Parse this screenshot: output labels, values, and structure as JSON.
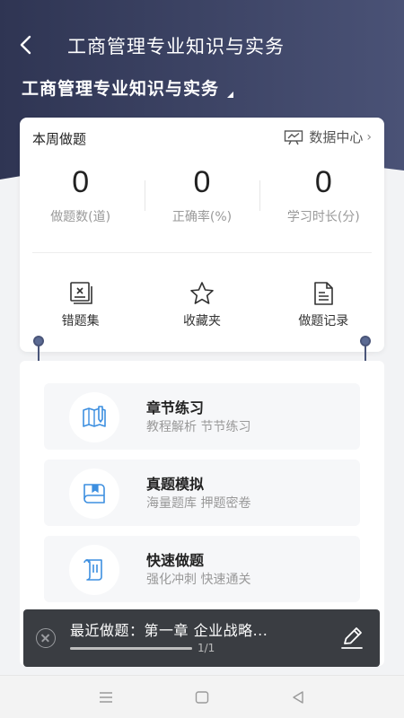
{
  "nav": {
    "title": "工商管理专业知识与实务",
    "back_icon": "back-arrow-icon"
  },
  "subject": {
    "name": "工商管理专业知识与实务"
  },
  "weekly": {
    "title": "本周做题",
    "data_center_label": "数据中心",
    "stats": [
      {
        "value": "0",
        "label": "做题数(道)"
      },
      {
        "value": "0",
        "label": "正确率(%)"
      },
      {
        "value": "0",
        "label": "学习时长(分)"
      }
    ],
    "tools": [
      {
        "label": "错题集",
        "icon": "wrong-questions-icon"
      },
      {
        "label": "收藏夹",
        "icon": "star-icon"
      },
      {
        "label": "做题记录",
        "icon": "document-icon"
      }
    ]
  },
  "modules": [
    {
      "title": "章节练习",
      "subtitle": "教程解析 节节练习",
      "icon": "chapter-practice-icon"
    },
    {
      "title": "真题模拟",
      "subtitle": "海量题库 押题密卷",
      "icon": "book-icon"
    },
    {
      "title": "快速做题",
      "subtitle": "强化冲刺 快速通关",
      "icon": "scroll-icon"
    }
  ],
  "recent": {
    "text": "最近做题：第一章 企业战略...",
    "page": "1/1",
    "progress": 1.0
  },
  "colors": {
    "header": "#3b4160",
    "accent": "#3d8fe0",
    "recent_bg": "#3a3d42"
  }
}
